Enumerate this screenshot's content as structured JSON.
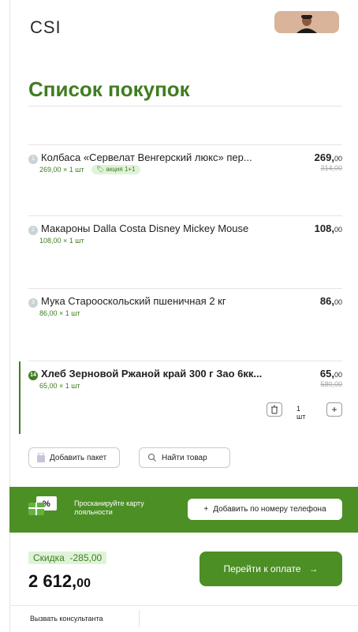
{
  "header": {
    "brand": "CSI"
  },
  "page": {
    "title": "Список покупок"
  },
  "items": [
    {
      "num": "1",
      "name": "Колбаса «Сервелат Венгерский люкс» пер...",
      "price_int": "269,",
      "price_frac": "00",
      "old_price": "314,00",
      "sub": "269,00 × 1 шт",
      "promo": "акция 1+1"
    },
    {
      "num": "2",
      "name": "Макароны Dalla Costa Disney Mickey Mouse",
      "price_int": "108,",
      "price_frac": "00",
      "sub": "108,00 × 1 шт"
    },
    {
      "num": "3",
      "name": "Мука Старооскольский пшеничная 2 кг",
      "price_int": "86,",
      "price_frac": "00",
      "sub": "86,00 × 1 шт"
    },
    {
      "num": "14",
      "name": "Хлеб Зерновой Ржаной край 300 г Зао 6кк...",
      "price_int": "65,",
      "price_frac": "00",
      "old_price": "580,00",
      "sub": "65,00 × 1 шт",
      "qty": "1 шт"
    }
  ],
  "actions": {
    "add_bag": "Добавить пакет",
    "find_item": "Найти товар"
  },
  "loyalty": {
    "text": "Просканируйте карту лояльности",
    "phone_button": "Добавить по номеру телефона"
  },
  "summary": {
    "discount_label": "Скидка",
    "discount_value": "-285,00",
    "total_int": "2 612,",
    "total_frac": "00",
    "pay_button": "Перейти к оплате"
  },
  "footer": {
    "consultant": "Вызвать консультанта"
  },
  "colors": {
    "accent": "#4c8f25",
    "accent_dark": "#3f7d21",
    "promo_bg": "#dff3d8"
  }
}
